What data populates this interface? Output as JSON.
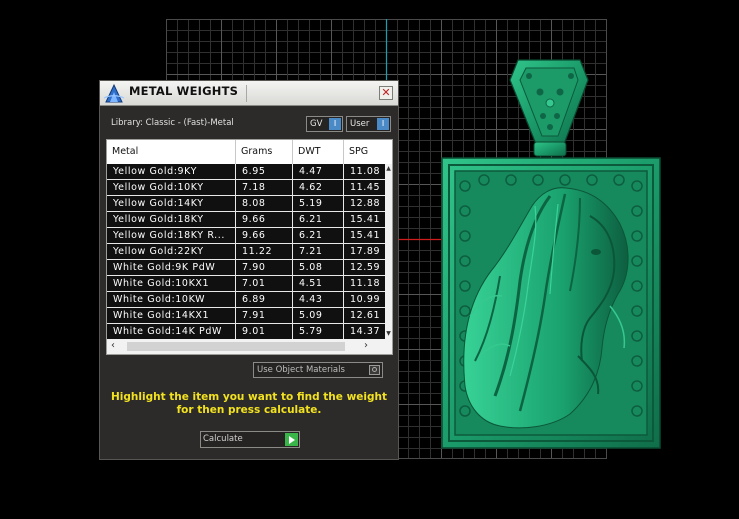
{
  "dialog": {
    "title": "METAL WEIGHTS",
    "close_glyph": "✕",
    "library_label": "Library: Classic - (Fast)-Metal",
    "toggles": [
      {
        "label": "GV",
        "indicator": "I"
      },
      {
        "label": "User",
        "indicator": "I"
      }
    ],
    "table": {
      "columns": [
        "Metal",
        "Grams",
        "DWT",
        "SPG"
      ],
      "rows": [
        [
          "Yellow Gold:9KY",
          "6.95",
          "4.47",
          "11.08"
        ],
        [
          "Yellow Gold:10KY",
          "7.18",
          "4.62",
          "11.45"
        ],
        [
          "Yellow Gold:14KY",
          "8.08",
          "5.19",
          "12.88"
        ],
        [
          "Yellow Gold:18KY",
          "9.66",
          "6.21",
          "15.41"
        ],
        [
          "Yellow Gold:18KY R...",
          "9.66",
          "6.21",
          "15.41"
        ],
        [
          "Yellow Gold:22KY",
          "11.22",
          "7.21",
          "17.89"
        ],
        [
          "White Gold:9K PdW",
          "7.90",
          "5.08",
          "12.59"
        ],
        [
          "White Gold:10KX1",
          "7.01",
          "4.51",
          "11.18"
        ],
        [
          "White Gold:10KW",
          "6.89",
          "4.43",
          "10.99"
        ],
        [
          "White Gold:14KX1",
          "7.91",
          "5.09",
          "12.61"
        ],
        [
          "White Gold:14K PdW",
          "9.01",
          "5.79",
          "14.37"
        ]
      ]
    },
    "use_object_materials": "Use Object Materials",
    "instruction_line1": "Highlight the item you want to find the weight",
    "instruction_line2": "for then press calculate.",
    "calculate_label": "Calculate"
  },
  "colors": {
    "pendant_green": "#1f9e6e",
    "instruction_yellow": "#f3e21f",
    "play_green": "#39b54a",
    "toggle_blue": "#4a8bc7"
  }
}
